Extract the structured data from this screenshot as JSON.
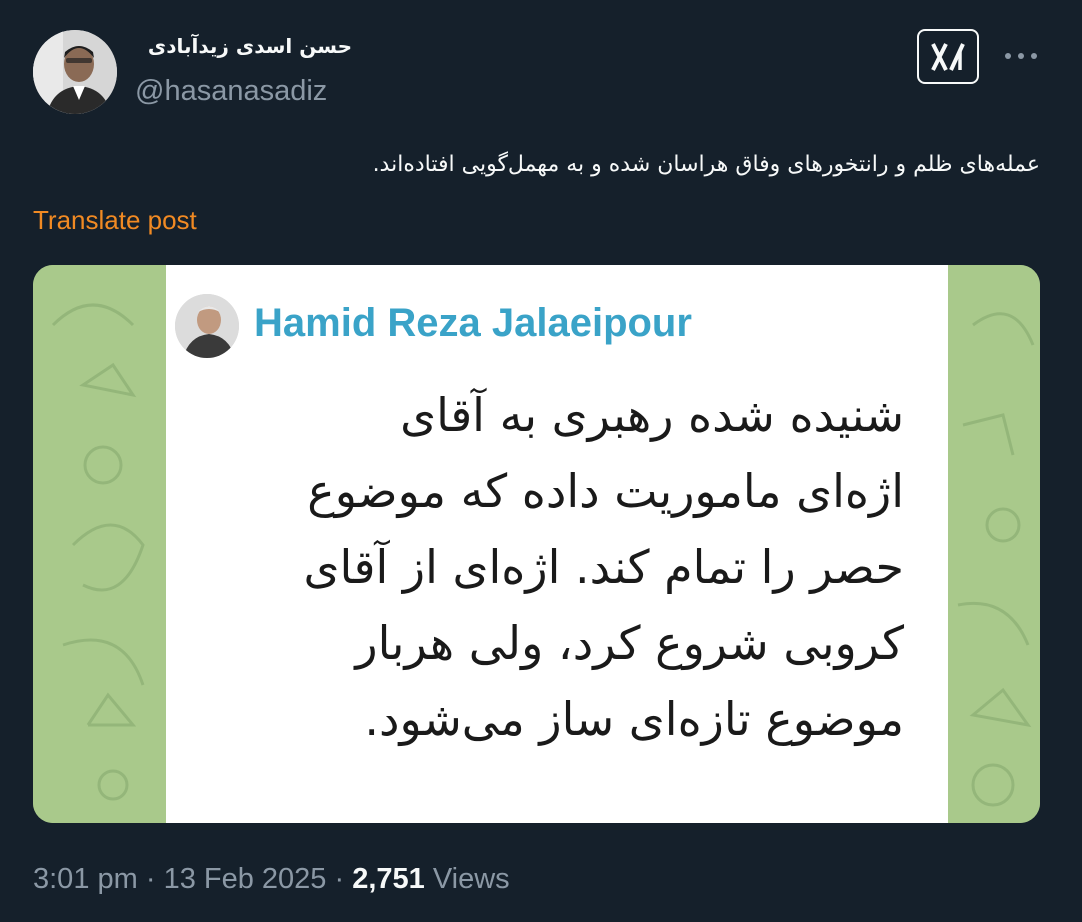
{
  "author": {
    "display_name": "حسن اسدی زیدآبادی",
    "handle": "@hasanasadiz"
  },
  "tweet": {
    "text": "عمله‌های ظلم و رانتخورهای وفاق هراسان شده و به مهمل‌گویی افتاده‌اند.",
    "translate_label": "Translate post"
  },
  "media": {
    "card_author": "Hamid Reza Jalaeipour",
    "lines": [
      "شنیده شده رهبری به آقای",
      "اژه‌ای ماموریت داده که موضوع",
      "حصر را تمام کند. اژه‌ای از آقای",
      "کروبی شروع کرد، ولی هربار",
      "موضوع تازه‌ای ساز می‌شود."
    ]
  },
  "meta": {
    "time": "3:01 pm",
    "sep1": " · ",
    "date": "13 Feb 2025",
    "sep2": " · ",
    "views_count": "2,751",
    "views_label": " Views"
  },
  "icons": {
    "grok": "grok-icon",
    "more": "more-icon"
  },
  "colors": {
    "background": "#15202b",
    "translate": "#f18a23",
    "secondary_text": "#8b98a5",
    "card_author": "#3aa3c8",
    "media_green": "#a8c98a"
  }
}
